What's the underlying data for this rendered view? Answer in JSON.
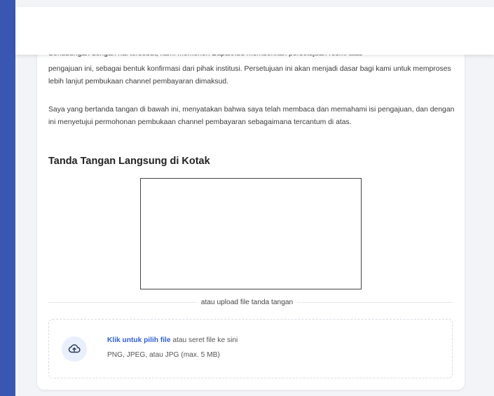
{
  "document": {
    "paragraphs": [
      "Sehubungan dengan hal tersebut, kami memohon Bapak/Ibu memberikan persetujuan resmi atas",
      "pengajuan ini, sebagai bentuk konfirmasi dari pihak institusi. Persetujuan ini akan menjadi dasar bagi kami untuk memproses lebih lanjut pembukaan channel pembayaran dimaksud.",
      "Saya yang bertanda tangan di bawah ini, menyatakan bahwa saya telah membaca dan memahami isi pengajuan, dan dengan ini menyetujui permohonan pembukaan channel pembayaran sebagaimana tercantum di atas."
    ]
  },
  "signature": {
    "title": "Tanda Tangan Langsung di Kotak",
    "upload_hint": "atau upload file tanda tangan"
  },
  "upload": {
    "icon": "cloud-upload-icon",
    "link_text": "Klik untuk pilih file",
    "rest_text": " atau seret file ke sini",
    "formats": "PNG, JPEG, atau JPG (max. 5 MB)",
    "accent_color": "#2f5fd6"
  }
}
